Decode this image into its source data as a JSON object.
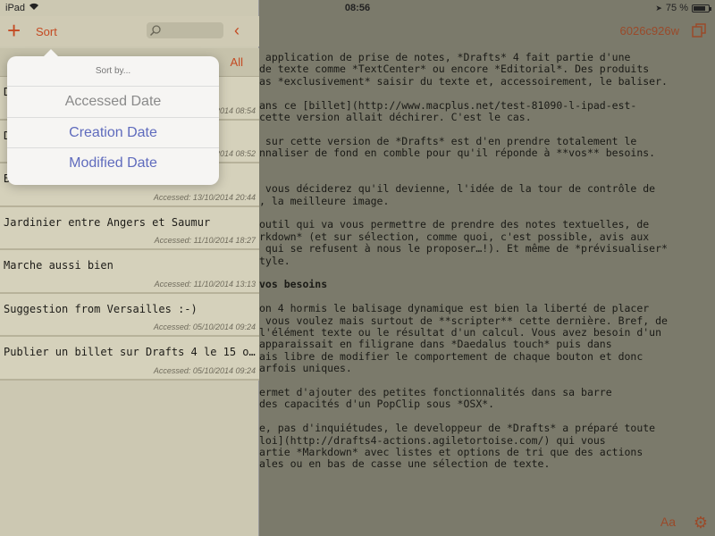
{
  "status_bar": {
    "device": "iPad",
    "time": "08:56",
    "battery": "75 %"
  },
  "editor": {
    "doc_id": "6026c926w",
    "lines": [
      " application de prise de notes, *Drafts* 4 fait partie d'une",
      "de texte comme *TextCenter* ou encore *Editorial*. Des produits",
      "as *exclusivement* saisir du texte et, accessoirement, le baliser.",
      "",
      "ans ce [billet](http://www.macplus.net/test-81090-l-ipad-est-",
      "cette version allait déchirer. C'est le cas.",
      "",
      " sur cette version de *Drafts* est d'en prendre totalement le",
      "nnaliser de fond en comble pour qu'il réponde à **vos** besoins.",
      "",
      "",
      " vous déciderez qu'il devienne, l'idée de la tour de contrôle de",
      ", la meilleure image.",
      "",
      "outil qui va vous permettre de prendre des notes textuelles, de",
      "rkdown* (et sur sélection, comme quoi, c'est possible, avis aux",
      " qui se refusent à nous le proposer…!). Et même de *prévisualiser*",
      "tyle.",
      "",
      "vos besoins",
      "",
      "on 4 hormis le balisage dynamique est bien la liberté de placer",
      " vous voulez mais surtout de **scripter** cette dernière. Bref, de",
      "l'élément texte ou le résultat d'un calcul. Vous avez besoin d'un",
      "apparaissait en filigrane dans *Daedalus touch* puis dans",
      "ais libre de modifier le comportement de chaque bouton et donc",
      "arfois uniques.",
      "",
      "ermet d'ajouter des petites fonctionnalités dans sa barre",
      "des capacités d'un PopClip sous *OSX*.",
      "",
      "e, pas d'inquiétudes, le developpeur de *Drafts* a préparé toute",
      "loi](http://drafts4-actions.agiletortoise.com/) qui vous",
      "artie *Markdown* avec listes et options de tri que des actions",
      "ales ou en bas de casse une sélection de texte."
    ],
    "font_button": "Aa"
  },
  "sidebar": {
    "sort_label": "Sort",
    "tab_all": "All",
    "rows": [
      {
        "title": "Drafts4",
        "date": "Accessed: 13/10/2014 08:54"
      },
      {
        "title": "Drafts4.version",
        "date": "Accessed: 13/10/2014 08:52"
      },
      {
        "title": "Bon, Adobe ... avec sa volo...",
        "date": "Accessed: 13/10/2014 20:44"
      },
      {
        "title": "Jardinier entre Angers et Saumur",
        "date": "Accessed: 11/10/2014 18:27"
      },
      {
        "title": "Marche aussi bien",
        "date": "Accessed: 11/10/2014 13:13"
      },
      {
        "title": "Suggestion from Versailles :-)",
        "date": "Accessed: 05/10/2014 09:24"
      },
      {
        "title": "Publier un billet sur Drafts 4 le 15 o...",
        "date": "Accessed: 05/10/2014 09:24"
      }
    ]
  },
  "popover": {
    "title": "Sort by...",
    "options": [
      "Accessed Date",
      "Creation Date",
      "Modified Date"
    ]
  }
}
